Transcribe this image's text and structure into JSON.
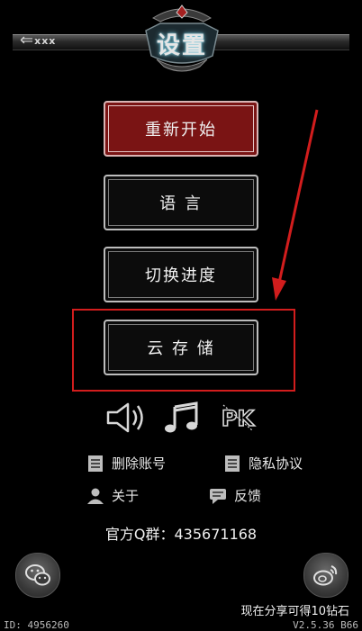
{
  "header": {
    "back_label": "xxx",
    "title": "设置"
  },
  "menu": {
    "restart": "重新开始",
    "language": "语 言",
    "switch_progress": "切换进度",
    "cloud_storage": "云 存 储"
  },
  "icons": {
    "sound": "speaker-icon",
    "music": "music-note-icon",
    "pk": "pk-icon"
  },
  "links": {
    "delete_account": "删除账号",
    "privacy_policy": "隐私协议",
    "about": "关于",
    "feedback": "反馈"
  },
  "qq_group": "官方Q群：435671168",
  "share_text": "现在分享可得10钻石",
  "user_id": "ID: 4956260",
  "version": "V2.5.36 B66",
  "colors": {
    "primary_button": "#7a1414",
    "highlight": "#d21d1d",
    "background": "#000000"
  }
}
